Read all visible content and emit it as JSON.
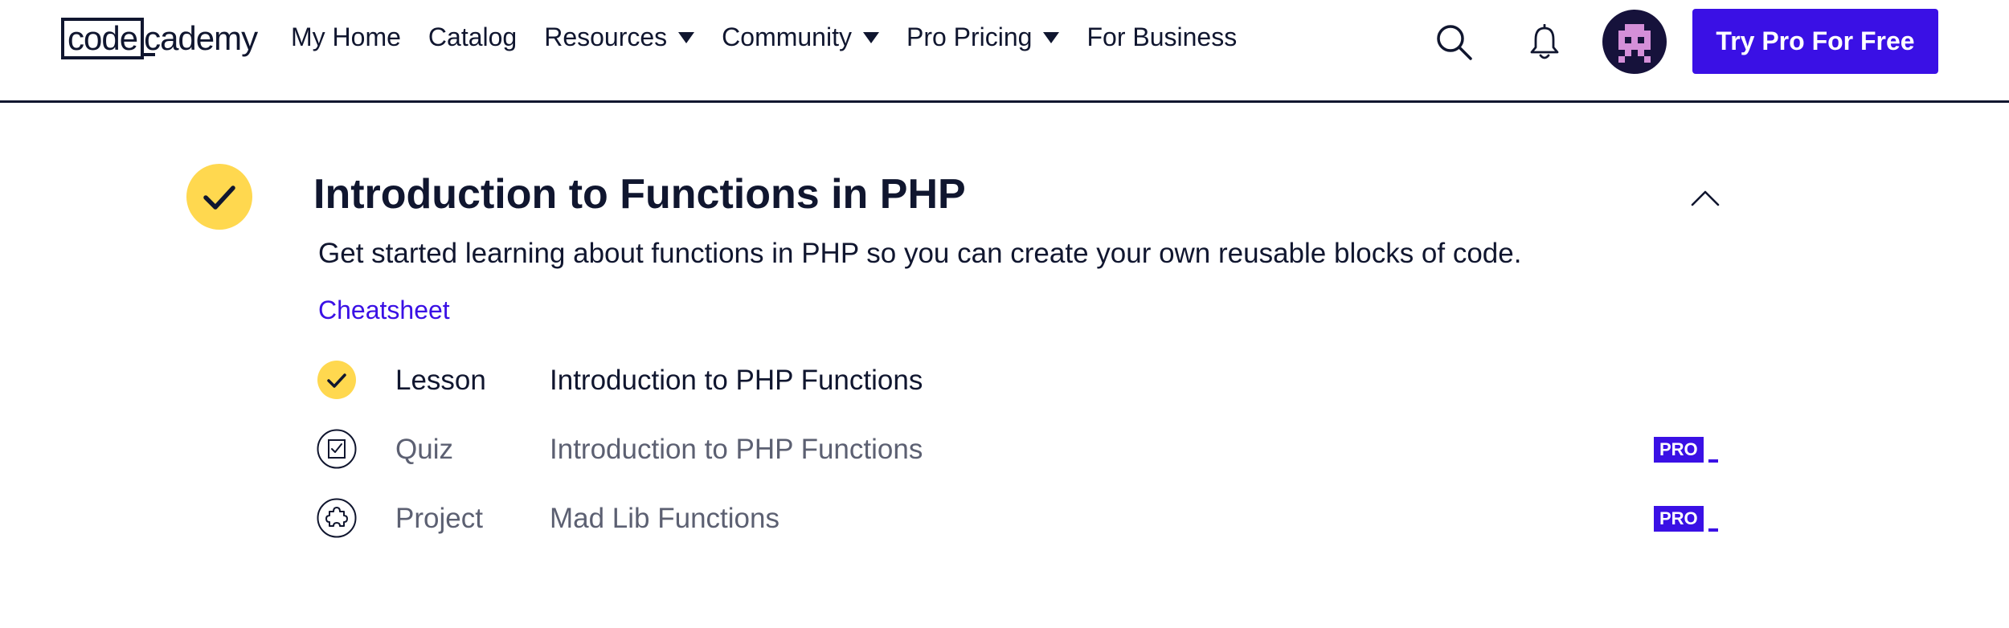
{
  "header": {
    "logo": {
      "part1": "code",
      "part2": "cademy"
    },
    "nav": [
      {
        "label": "My Home",
        "has_caret": false
      },
      {
        "label": "Catalog",
        "has_caret": false
      },
      {
        "label": "Resources",
        "has_caret": true
      },
      {
        "label": "Community",
        "has_caret": true
      },
      {
        "label": "Pro Pricing",
        "has_caret": true
      },
      {
        "label": "For Business",
        "has_caret": false
      }
    ],
    "icons": [
      "search-icon",
      "bell-icon"
    ],
    "cta_label": "Try Pro For Free"
  },
  "module": {
    "title": "Introduction to Functions in PHP",
    "description": "Get started learning about functions in PHP so you can create your own reusable blocks of code.",
    "cheatsheet_label": "Cheatsheet",
    "completed": true,
    "items": [
      {
        "type": "Lesson",
        "name": "Introduction to PHP Functions",
        "status": "completed",
        "icon": "check-icon",
        "pro": false
      },
      {
        "type": "Quiz",
        "name": "Introduction to PHP Functions",
        "status": "locked",
        "icon": "quiz-icon",
        "pro": true,
        "pro_label": "PRO"
      },
      {
        "type": "Project",
        "name": "Mad Lib Functions",
        "status": "locked",
        "icon": "puzzle-icon",
        "pro": true,
        "pro_label": "PRO"
      }
    ]
  },
  "colors": {
    "navy": "#10162f",
    "brand_blue": "#3a10e5",
    "yellow": "#ffd84f",
    "muted_text": "#5c6072",
    "avatar_bg": "#16123b",
    "avatar_pink": "#d48fd8"
  }
}
